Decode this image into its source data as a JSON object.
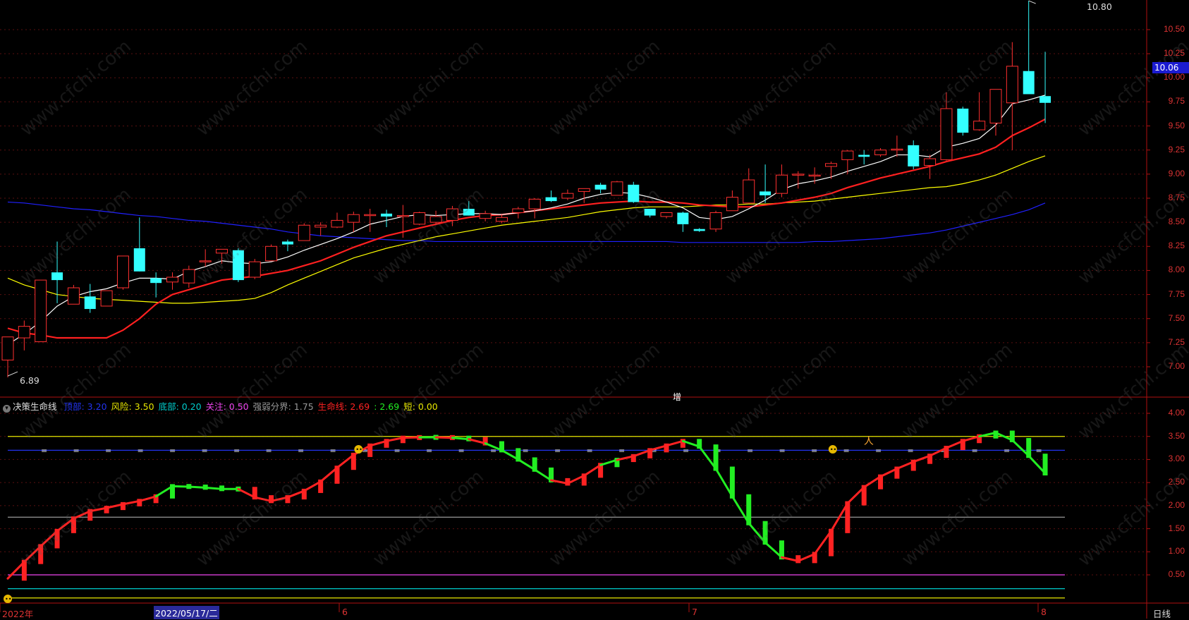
{
  "window": {
    "period_label": "日线",
    "extra_label": "增"
  },
  "price_axis": {
    "ticks": [
      "10.50",
      "10.25",
      "10.00",
      "9.75",
      "9.50",
      "9.25",
      "9.00",
      "8.75",
      "8.50",
      "8.25",
      "8.00",
      "7.75",
      "7.50",
      "7.25",
      "7.00"
    ]
  },
  "price_labels": {
    "high": "10.80",
    "low": "6.89",
    "current": "10.06"
  },
  "indicator": {
    "name": "决策生命线",
    "legend": [
      {
        "label": "顶部: 3.20",
        "color": "#2233ee"
      },
      {
        "label": "风险: 3.50",
        "color": "#e6e600"
      },
      {
        "label": "底部: 0.20",
        "color": "#00cccc"
      },
      {
        "label": "关注: 0.50",
        "color": "#ee44ee"
      },
      {
        "label": "强弱分界: 1.75",
        "color": "#999999"
      },
      {
        "label": "生命线: 2.69",
        "color": "#ff2222"
      },
      {
        "label": ": 2.69",
        "color": "#22ee22"
      },
      {
        "label": "短: 0.00",
        "color": "#e6e600"
      }
    ],
    "axis_ticks": [
      "4.00",
      "3.50",
      "3.00",
      "2.50",
      "2.00",
      "1.50",
      "1.00",
      "0.50"
    ]
  },
  "date_axis": {
    "year_label": "2022年",
    "cursor_date": "2022/05/17/二",
    "month_labels": [
      "6",
      "7",
      "8"
    ]
  },
  "watermark": "www.cfchi.com",
  "colors": {
    "up": "#ff3030",
    "down": "#33ffff",
    "ma5": "#ffffff",
    "ma10": "#ff2020",
    "ma20": "#ffff00",
    "ma60": "#2020ff"
  },
  "chart_data": {
    "type": "candlestick",
    "ylim": [
      6.85,
      10.85
    ],
    "candles": [
      [
        7.07,
        7.31,
        7.22,
        6.89
      ],
      [
        7.3,
        7.42,
        7.48,
        7.17
      ],
      [
        7.26,
        7.9,
        7.9,
        7.26
      ],
      [
        7.98,
        7.9,
        8.3,
        7.66
      ],
      [
        7.65,
        7.82,
        7.85,
        7.65
      ],
      [
        7.73,
        7.6,
        7.86,
        7.56
      ],
      [
        7.63,
        7.79,
        7.79,
        7.63
      ],
      [
        7.82,
        8.15,
        8.15,
        7.8
      ],
      [
        8.23,
        7.99,
        8.55,
        7.99
      ],
      [
        7.92,
        7.87,
        7.98,
        7.72
      ],
      [
        7.88,
        7.93,
        7.98,
        7.8
      ],
      [
        7.87,
        8.01,
        8.05,
        7.82
      ],
      [
        8.1,
        8.1,
        8.22,
        8.04
      ],
      [
        8.18,
        8.22,
        8.22,
        8.07
      ],
      [
        8.21,
        7.9,
        8.23,
        7.88
      ],
      [
        7.93,
        8.09,
        8.12,
        7.91
      ],
      [
        8.1,
        8.25,
        8.27,
        8.1
      ],
      [
        8.3,
        8.27,
        8.32,
        8.2
      ],
      [
        8.31,
        8.47,
        8.49,
        8.31
      ],
      [
        8.45,
        8.47,
        8.5,
        8.36
      ],
      [
        8.45,
        8.52,
        8.6,
        8.44
      ],
      [
        8.5,
        8.58,
        8.61,
        8.4
      ],
      [
        8.57,
        8.58,
        8.64,
        8.4
      ],
      [
        8.59,
        8.56,
        8.63,
        8.45
      ],
      [
        8.57,
        8.57,
        8.68,
        8.34
      ],
      [
        8.48,
        8.6,
        8.61,
        8.47
      ],
      [
        8.5,
        8.56,
        8.62,
        8.48
      ],
      [
        8.52,
        8.64,
        8.67,
        8.46
      ],
      [
        8.64,
        8.57,
        8.72,
        8.57
      ],
      [
        8.54,
        8.59,
        8.62,
        8.51
      ],
      [
        8.51,
        8.55,
        8.58,
        8.49
      ],
      [
        8.6,
        8.64,
        8.66,
        8.54
      ],
      [
        8.64,
        8.74,
        8.75,
        8.54
      ],
      [
        8.76,
        8.72,
        8.83,
        8.71
      ],
      [
        8.75,
        8.8,
        8.84,
        8.73
      ],
      [
        8.82,
        8.85,
        8.85,
        8.7
      ],
      [
        8.89,
        8.84,
        8.91,
        8.8
      ],
      [
        8.78,
        8.92,
        8.93,
        8.78
      ],
      [
        8.89,
        8.71,
        8.92,
        8.7
      ],
      [
        8.64,
        8.57,
        8.64,
        8.55
      ],
      [
        8.56,
        8.6,
        8.6,
        8.54
      ],
      [
        8.6,
        8.48,
        8.61,
        8.4
      ],
      [
        8.43,
        8.41,
        8.44,
        8.4
      ],
      [
        8.43,
        8.6,
        8.62,
        8.4
      ],
      [
        8.62,
        8.76,
        8.83,
        8.62
      ],
      [
        8.7,
        8.94,
        9.06,
        8.7
      ],
      [
        8.82,
        8.78,
        9.1,
        8.7
      ],
      [
        8.8,
        8.99,
        9.1,
        8.76
      ],
      [
        9.0,
        9.0,
        9.03,
        8.85
      ],
      [
        8.98,
        8.99,
        9.07,
        8.9
      ],
      [
        9.08,
        9.11,
        9.13,
        8.95
      ],
      [
        9.15,
        9.24,
        9.25,
        9.0
      ],
      [
        9.2,
        9.18,
        9.25,
        9.1
      ],
      [
        9.2,
        9.25,
        9.27,
        9.18
      ],
      [
        9.26,
        9.26,
        9.4,
        9.18
      ],
      [
        9.3,
        9.08,
        9.35,
        9.05
      ],
      [
        9.09,
        9.16,
        9.2,
        8.95
      ],
      [
        9.15,
        9.68,
        9.85,
        9.14
      ],
      [
        9.68,
        9.43,
        9.7,
        9.4
      ],
      [
        9.46,
        9.55,
        9.85,
        9.45
      ],
      [
        9.53,
        9.88,
        9.88,
        9.4
      ],
      [
        9.74,
        10.12,
        10.37,
        9.25
      ],
      [
        10.07,
        9.83,
        10.8,
        9.83
      ],
      [
        9.81,
        9.74,
        10.27,
        9.53
      ]
    ],
    "ma5": [
      7.23,
      7.34,
      7.47,
      7.63,
      7.73,
      7.78,
      7.81,
      7.87,
      7.92,
      7.92,
      7.91,
      7.99,
      8.04,
      8.1,
      8.08,
      8.07,
      8.09,
      8.14,
      8.21,
      8.27,
      8.33,
      8.4,
      8.48,
      8.52,
      8.56,
      8.58,
      8.57,
      8.58,
      8.59,
      8.59,
      8.58,
      8.6,
      8.62,
      8.65,
      8.69,
      8.75,
      8.79,
      8.81,
      8.8,
      8.76,
      8.71,
      8.65,
      8.55,
      8.53,
      8.56,
      8.64,
      8.73,
      8.84,
      8.9,
      8.93,
      8.97,
      9.03,
      9.08,
      9.13,
      9.2,
      9.2,
      9.18,
      9.28,
      9.32,
      9.37,
      9.51,
      9.73,
      9.77,
      9.82
    ],
    "ma10": [
      7.4,
      7.35,
      7.33,
      7.3,
      7.3,
      7.3,
      7.3,
      7.38,
      7.5,
      7.65,
      7.75,
      7.8,
      7.85,
      7.9,
      7.92,
      7.94,
      7.97,
      8.0,
      8.05,
      8.1,
      8.17,
      8.24,
      8.3,
      8.36,
      8.4,
      8.44,
      8.48,
      8.52,
      8.55,
      8.57,
      8.58,
      8.6,
      8.62,
      8.64,
      8.66,
      8.68,
      8.7,
      8.71,
      8.72,
      8.71,
      8.71,
      8.7,
      8.68,
      8.67,
      8.66,
      8.66,
      8.68,
      8.7,
      8.73,
      8.76,
      8.8,
      8.86,
      8.91,
      8.96,
      9.0,
      9.04,
      9.08,
      9.13,
      9.17,
      9.21,
      9.28,
      9.4,
      9.48,
      9.57
    ],
    "ma20": [
      7.92,
      7.85,
      7.8,
      7.75,
      7.73,
      7.71,
      7.7,
      7.69,
      7.68,
      7.67,
      7.66,
      7.66,
      7.67,
      7.68,
      7.69,
      7.71,
      7.77,
      7.85,
      7.92,
      7.99,
      8.06,
      8.13,
      8.18,
      8.23,
      8.27,
      8.31,
      8.35,
      8.38,
      8.41,
      8.44,
      8.47,
      8.49,
      8.51,
      8.53,
      8.55,
      8.58,
      8.61,
      8.63,
      8.65,
      8.66,
      8.66,
      8.66,
      8.67,
      8.68,
      8.68,
      8.69,
      8.69,
      8.7,
      8.71,
      8.72,
      8.74,
      8.76,
      8.78,
      8.8,
      8.82,
      8.84,
      8.86,
      8.87,
      8.9,
      8.94,
      8.99,
      9.06,
      9.13,
      9.19
    ],
    "ma60": [
      8.71,
      8.7,
      8.68,
      8.66,
      8.64,
      8.63,
      8.61,
      8.59,
      8.57,
      8.56,
      8.54,
      8.52,
      8.51,
      8.49,
      8.47,
      8.45,
      8.43,
      8.4,
      8.38,
      8.36,
      8.35,
      8.34,
      8.33,
      8.32,
      8.31,
      8.31,
      8.3,
      8.3,
      8.3,
      8.3,
      8.3,
      8.3,
      8.3,
      8.3,
      8.3,
      8.3,
      8.3,
      8.3,
      8.3,
      8.3,
      8.3,
      8.29,
      8.29,
      8.29,
      8.29,
      8.29,
      8.29,
      8.29,
      8.29,
      8.3,
      8.3,
      8.31,
      8.32,
      8.33,
      8.35,
      8.37,
      8.39,
      8.42,
      8.46,
      8.5,
      8.54,
      8.58,
      8.63,
      8.7
    ],
    "life_line": [
      0.42,
      0.78,
      1.12,
      1.45,
      1.72,
      1.88,
      1.95,
      2.03,
      2.1,
      2.2,
      2.42,
      2.41,
      2.39,
      2.36,
      2.36,
      2.18,
      2.1,
      2.18,
      2.32,
      2.52,
      2.82,
      3.1,
      3.3,
      3.4,
      3.47,
      3.48,
      3.48,
      3.47,
      3.44,
      3.35,
      3.2,
      3.0,
      2.78,
      2.55,
      2.48,
      2.65,
      2.88,
      2.99,
      3.07,
      3.2,
      3.3,
      3.4,
      3.28,
      2.8,
      2.2,
      1.62,
      1.2,
      0.88,
      0.8,
      0.95,
      1.45,
      2.05,
      2.4,
      2.63,
      2.8,
      2.95,
      3.08,
      3.25,
      3.4,
      3.5,
      3.58,
      3.42,
      3.08,
      2.7
    ],
    "life_up": [
      1,
      1,
      1,
      1,
      1,
      1,
      1,
      1,
      1,
      1,
      0,
      0,
      0,
      0,
      0,
      1,
      1,
      1,
      1,
      1,
      1,
      1,
      1,
      1,
      1,
      1,
      0,
      1,
      0,
      1,
      0,
      0,
      0,
      0,
      1,
      1,
      1,
      0,
      1,
      1,
      1,
      1,
      0,
      0,
      0,
      0,
      0,
      0,
      1,
      1,
      1,
      1,
      1,
      1,
      1,
      1,
      1,
      1,
      1,
      1,
      0,
      0,
      0,
      0
    ]
  }
}
